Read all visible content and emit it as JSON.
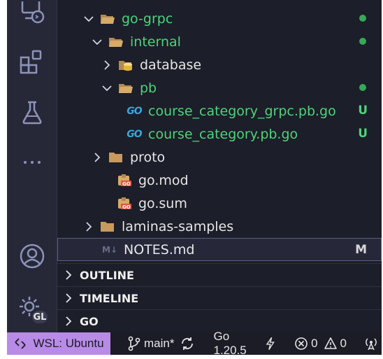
{
  "activity_bar": {
    "icons": [
      "remote-explorer-icon",
      "extensions-icon",
      "testing-icon",
      "more-icon",
      "account-icon",
      "manage-gear-icon"
    ],
    "manage_badge": "GL"
  },
  "explorer": {
    "items": [
      {
        "name": "go-grpc",
        "type": "folder",
        "expanded": true,
        "color": "green",
        "indicator": "dot"
      },
      {
        "name": "internal",
        "type": "folder",
        "expanded": true,
        "color": "green",
        "indicator": "dot"
      },
      {
        "name": "database",
        "type": "folder-db",
        "expanded": false,
        "color": "normal"
      },
      {
        "name": "pb",
        "type": "folder",
        "expanded": true,
        "color": "green",
        "indicator": "dot"
      },
      {
        "name": "course_category_grpc.pb.go",
        "type": "go-file",
        "color": "green",
        "status": "U"
      },
      {
        "name": "course_category.pb.go",
        "type": "go-file",
        "color": "green",
        "status": "U"
      },
      {
        "name": "proto",
        "type": "folder",
        "expanded": false,
        "color": "normal"
      },
      {
        "name": "go.mod",
        "type": "go-mod",
        "color": "normal"
      },
      {
        "name": "go.sum",
        "type": "go-mod",
        "color": "normal"
      },
      {
        "name": "laminas-samples",
        "type": "folder",
        "expanded": false,
        "color": "normal"
      },
      {
        "name": "NOTES.md",
        "type": "md-file",
        "color": "normal",
        "status": "M",
        "selected": true
      }
    ],
    "go_icon_text": "GO",
    "md_icon_text": "M↓"
  },
  "sections": [
    "OUTLINE",
    "TIMELINE",
    "GO"
  ],
  "status_bar": {
    "remote": "WSL: Ubuntu",
    "branch": "main*",
    "go_version": "Go 1.20.5",
    "errors": "0",
    "warnings": "0"
  },
  "colors": {
    "git_added": "#4fd37a",
    "git_modified": "#d7d7d7",
    "remote_bg": "#b88be6",
    "go_icon": "#3aa6d9"
  }
}
